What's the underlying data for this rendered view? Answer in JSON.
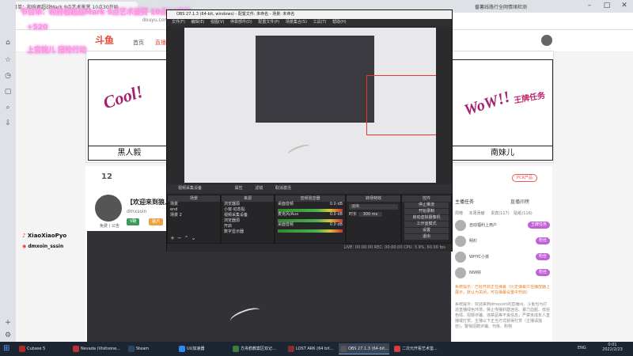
{
  "browser": {
    "tabs": [
      {
        "label": "节目单：和府君超战Mark 9点艺术鉴赏 10点30开始"
      },
      {
        "label": "【欢迎来到狼人杀】..."
      }
    ],
    "right_tab": "番薯线路行全网情绪检测",
    "addressbar": "douyu.com"
  },
  "overlay_texts": {
    "line1": "节目单：和府君超战Mark 9点艺术鉴赏 10点30开始",
    "line2": "+520",
    "line3": "上官婉儿 猎枪行动"
  },
  "site": {
    "logo": "斗鱼",
    "nav_home": "首页",
    "nav_live": "直播"
  },
  "posters": {
    "left_label": "黑人毅",
    "right_label": "南妹儿",
    "left_graffiti": "Cool!",
    "right_graffiti": "WoW!!",
    "right_badge": "王牌任务"
  },
  "anchor": {
    "level": "12",
    "room_title": "【欢迎来到狼人杀】",
    "name": "dmxsoin",
    "follow_label": "免费丨公告",
    "vip_label": "V聊",
    "tag_label": "猛犬"
  },
  "social": {
    "tiktok_handle": "XiaoXiaoPyo",
    "weibo_handle": "dmxoin_sssin"
  },
  "right_panel": {
    "pk_label": "PCR产品",
    "live_tab": "直播间榜",
    "tabs": [
      "主播任务",
      "粉丝榜"
    ],
    "subtabs": [
      "周榜",
      "本周贡献",
      "贵宾(117)",
      "贴纸(116)"
    ],
    "users": [
      {
        "name": "自动福利上用户",
        "badge": "王牌任务"
      },
      {
        "name": "明杉",
        "badge": "粉丝"
      },
      {
        "name": "WHYC小孩",
        "badge": "粉丝"
      },
      {
        "name": "NIW好",
        "badge": "粉丝"
      }
    ],
    "chat": [
      "系统提示：已经开启正在弹幕（历史弹幕只在播放器上展示，默认为关闭，可在弹幕设置中开启）",
      "系统提示：欢迎来到dmxsoin的直播间。斗鱼也为打造直播绿色环境，禁止传播封建迷信、暴力血腥、低俗色情、招嫖诈骗、违禁品等不良信息，严禁未成年人直播或打赏。主播以下正当方式获得打赏（主播请独自)，警惕招聘诈骗、代练、购物"
    ]
  },
  "obs": {
    "title": "OBS 27.1.3 (64-bit, windows) - 配置文件: 未命名 - 场景: 未命名",
    "menu": [
      "文件(F)",
      "编辑(E)",
      "视图(V)",
      "停靠部件(D)",
      "配置文件(P)",
      "场景集合(S)",
      "工具(T)",
      "帮助(H)"
    ],
    "toolbar": {
      "source": "视频采集设备",
      "props": "属性",
      "filter": "滤镜",
      "deactivate": "取消激活"
    },
    "scenes": {
      "title": "场景",
      "items": [
        "场景",
        "end",
        "场景 2"
      ]
    },
    "sources": {
      "title": "来源",
      "items": [
        "浏览器源",
        "小窗·动态贴",
        "视频采集设备",
        "浏览器源",
        "开启",
        "数字显示器"
      ]
    },
    "mixer": {
      "title": "音频混音器",
      "tracks": [
        {
          "name": "桌面音频",
          "db": "0.0 dB"
        },
        {
          "name": "麦克风/Aux",
          "db": "0.0 dB"
        },
        {
          "name": "桌面音频",
          "db": "0.0 dB"
        }
      ]
    },
    "transitions": {
      "title": "转场特效",
      "mode": "淡出",
      "duration_label": "时长",
      "duration": "300 ms"
    },
    "controls": {
      "title": "控件",
      "buttons": [
        "停止推流",
        "开始录制",
        "启动虚拟摄像机",
        "工作室模式",
        "设置",
        "退出"
      ]
    },
    "status": "LIVE: 00:00:00   REC: 00:00:00   CPU: 3.9%, 60.00 fps"
  },
  "taskbar": {
    "apps": [
      {
        "name": "Cubase 5",
        "color": "#b02a2a"
      },
      {
        "name": "Nevada (Visitsone...",
        "color": "#c03030"
      },
      {
        "name": "Steam",
        "color": "#2a475e"
      },
      {
        "name": "UU加速器",
        "color": "#2d8cf0"
      },
      {
        "name": "方舟鹤教案区双记...",
        "color": "#3a7d44"
      },
      {
        "name": "LOST ARK (64 bit...",
        "color": "#8b2b2b"
      },
      {
        "name": "OBS 27.1.3 (64-bit...",
        "color": "#333"
      },
      {
        "name": "二次元开看艺术鉴...",
        "color": "#d04040"
      }
    ],
    "lang": "ENG",
    "time": "0:01",
    "date": "2022/2/23"
  }
}
